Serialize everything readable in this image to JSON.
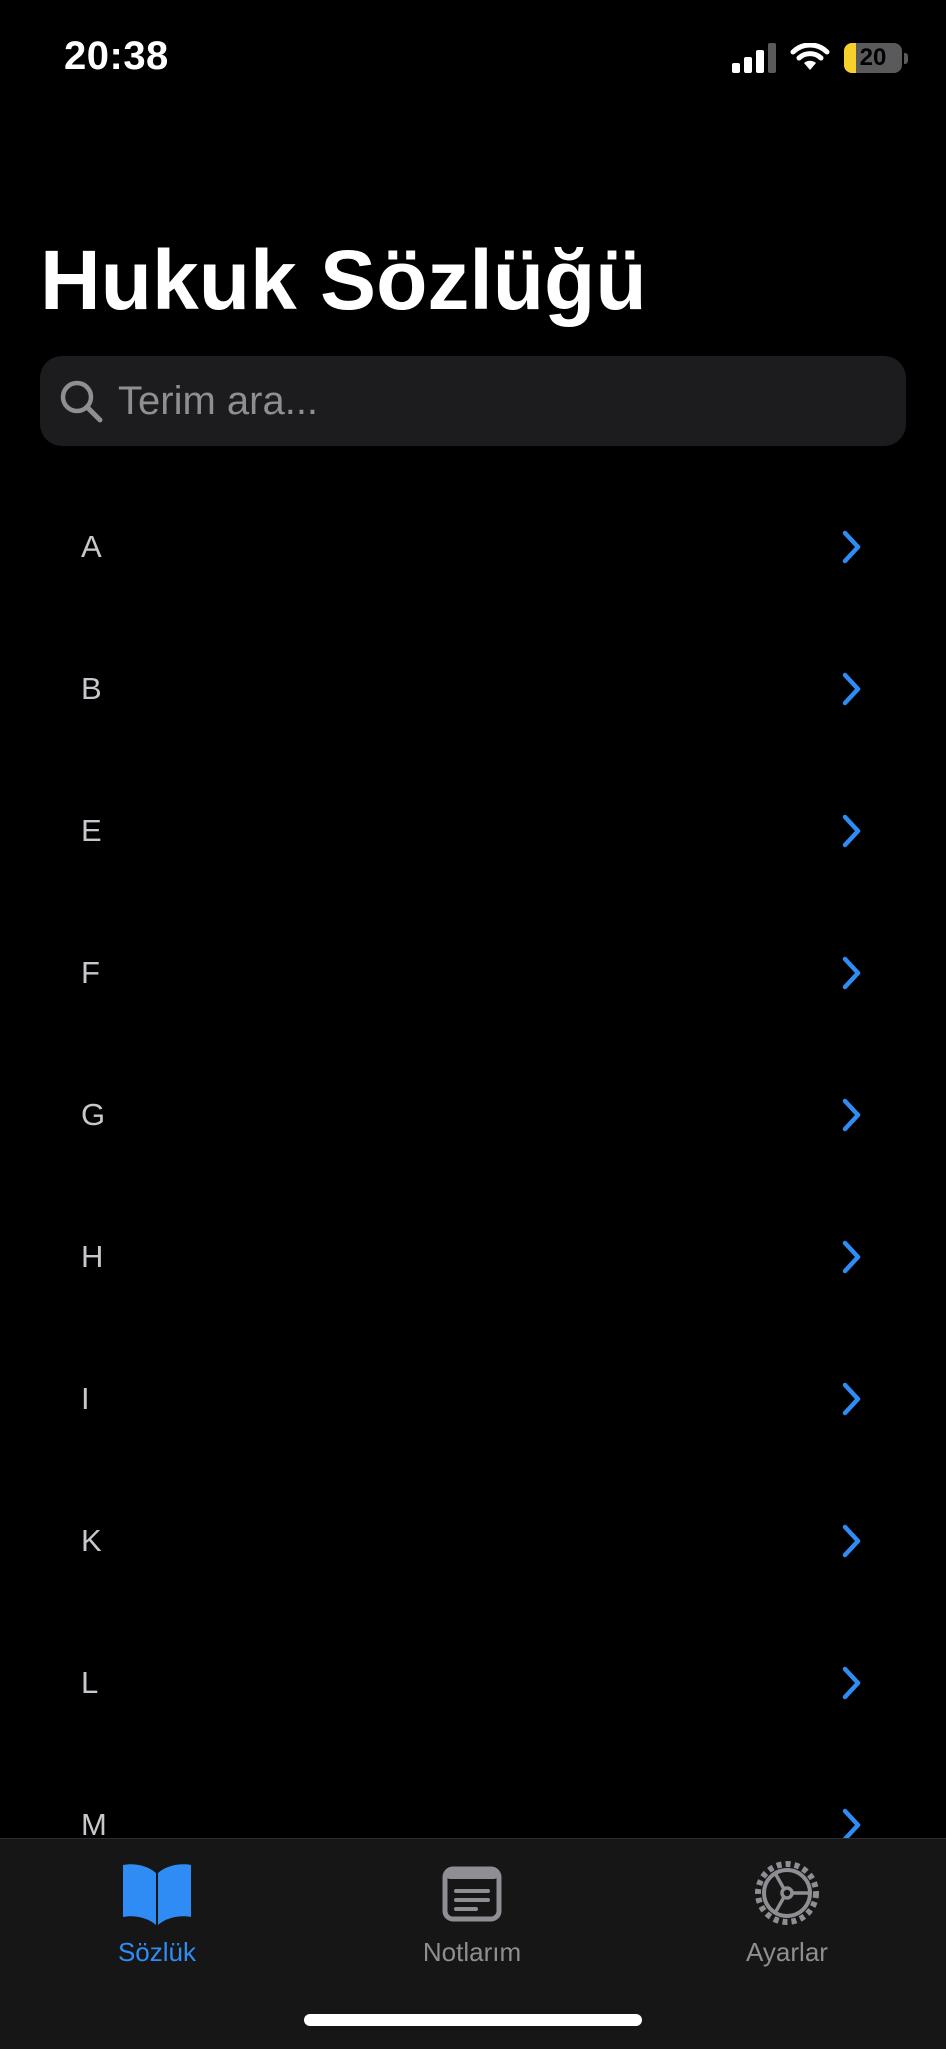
{
  "status_bar": {
    "time": "20:38",
    "battery_level": "20",
    "battery_fraction": 0.2,
    "battery_color": "#f7d02b"
  },
  "header": {
    "title": "Hukuk Sözlüğü"
  },
  "search": {
    "placeholder": "Terim ara...",
    "value": "",
    "icon": "magnifying-glass-icon"
  },
  "letters": {
    "items": [
      {
        "label": "A"
      },
      {
        "label": "B"
      },
      {
        "label": "E"
      },
      {
        "label": "F"
      },
      {
        "label": "G"
      },
      {
        "label": "H"
      },
      {
        "label": "I"
      },
      {
        "label": "K"
      },
      {
        "label": "L"
      },
      {
        "label": "M"
      }
    ],
    "chevron_icon": "chevron-right-icon",
    "chevron_color": "#2f8cf5"
  },
  "tab_bar": {
    "tabs": [
      {
        "label": "Sözlük",
        "icon": "book-icon",
        "active": true
      },
      {
        "label": "Notlarım",
        "icon": "notes-icon",
        "active": false
      },
      {
        "label": "Ayarlar",
        "icon": "gear-icon",
        "active": false
      }
    ],
    "active_color": "#2f8cf5",
    "inactive_color": "#8e8e93"
  }
}
